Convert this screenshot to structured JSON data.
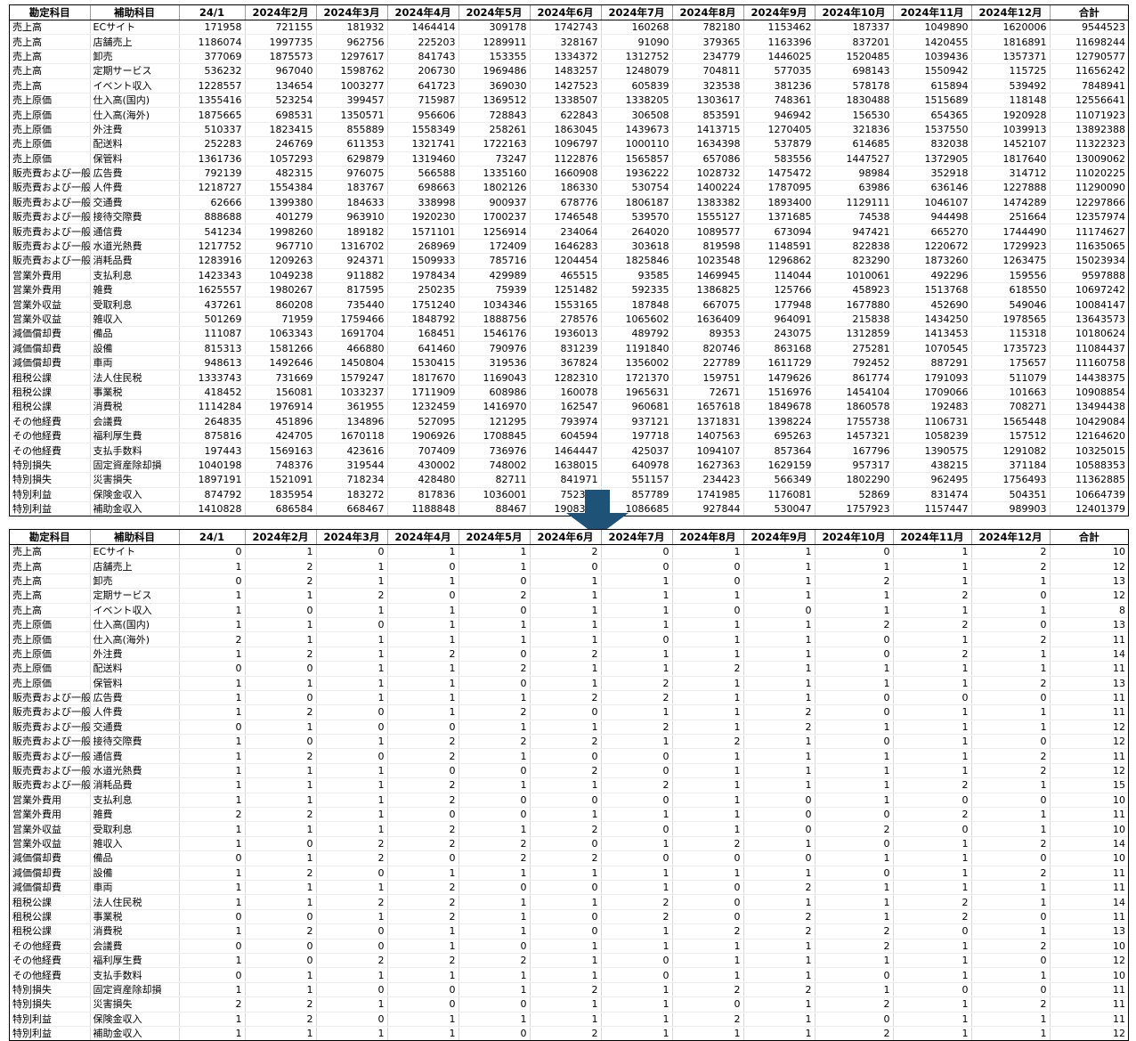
{
  "headers": [
    "勘定科目",
    "補助科目",
    "24/1",
    "2024年2月",
    "2024年3月",
    "2024年4月",
    "2024年5月",
    "2024年6月",
    "2024年7月",
    "2024年8月",
    "2024年9月",
    "2024年10月",
    "2024年11月",
    "2024年12月",
    "合計"
  ],
  "accent_colors": {
    "arrow": "#1f5277",
    "grid_line": "#d9d9d9",
    "border": "#000000"
  },
  "icons": {
    "arrow": "down-arrow-icon"
  },
  "top_rows": [
    [
      "売上高",
      "ECサイト",
      "171958",
      "721155",
      "181932",
      "1464414",
      "309178",
      "1742743",
      "160268",
      "782180",
      "1153462",
      "187337",
      "1049890",
      "1620006",
      "9544523"
    ],
    [
      "売上高",
      "店舗売上",
      "1186074",
      "1997735",
      "962756",
      "225203",
      "1289911",
      "328167",
      "91090",
      "379365",
      "1163396",
      "837201",
      "1420455",
      "1816891",
      "11698244"
    ],
    [
      "売上高",
      "卸売",
      "377069",
      "1875573",
      "1297617",
      "841743",
      "153355",
      "1334372",
      "1312752",
      "234779",
      "1446025",
      "1520485",
      "1039436",
      "1357371",
      "12790577"
    ],
    [
      "売上高",
      "定期サービス",
      "536232",
      "967040",
      "1598762",
      "206730",
      "1969486",
      "1483257",
      "1248079",
      "704811",
      "577035",
      "698143",
      "1550942",
      "115725",
      "11656242"
    ],
    [
      "売上高",
      "イベント収入",
      "1228557",
      "134654",
      "1003277",
      "641723",
      "369030",
      "1427523",
      "605839",
      "323538",
      "381236",
      "578178",
      "615894",
      "539492",
      "7848941"
    ],
    [
      "売上原価",
      "仕入高(国内)",
      "1355416",
      "523254",
      "399457",
      "715987",
      "1369512",
      "1338507",
      "1338205",
      "1303617",
      "748361",
      "1830488",
      "1515689",
      "118148",
      "12556641"
    ],
    [
      "売上原価",
      "仕入高(海外)",
      "1875665",
      "698531",
      "1350571",
      "956606",
      "728843",
      "622843",
      "306508",
      "853591",
      "946942",
      "156530",
      "654365",
      "1920928",
      "11071923"
    ],
    [
      "売上原価",
      "外注費",
      "510337",
      "1823415",
      "855889",
      "1558349",
      "258261",
      "1863045",
      "1439673",
      "1413715",
      "1270405",
      "321836",
      "1537550",
      "1039913",
      "13892388"
    ],
    [
      "売上原価",
      "配送料",
      "252283",
      "246769",
      "611353",
      "1321741",
      "1722163",
      "1096797",
      "1000110",
      "1634398",
      "537879",
      "614685",
      "832038",
      "1452107",
      "11322323"
    ],
    [
      "売上原価",
      "保管料",
      "1361736",
      "1057293",
      "629879",
      "1319460",
      "73247",
      "1122876",
      "1565857",
      "657086",
      "583556",
      "1447527",
      "1372905",
      "1817640",
      "13009062"
    ],
    [
      "販売費および一般管理費",
      "広告費",
      "792139",
      "482315",
      "976075",
      "566588",
      "1335160",
      "1660908",
      "1936222",
      "1028732",
      "1475472",
      "98984",
      "352918",
      "314712",
      "11020225"
    ],
    [
      "販売費および一般管理費",
      "人件費",
      "1218727",
      "1554384",
      "183767",
      "698663",
      "1802126",
      "186330",
      "530754",
      "1400224",
      "1787095",
      "63986",
      "636146",
      "1227888",
      "11290090"
    ],
    [
      "販売費および一般管理費",
      "交通費",
      "62666",
      "1399380",
      "184633",
      "338998",
      "900937",
      "678776",
      "1806187",
      "1383382",
      "1893400",
      "1129111",
      "1046107",
      "1474289",
      "12297866"
    ],
    [
      "販売費および一般管理費",
      "接待交際費",
      "888688",
      "401279",
      "963910",
      "1920230",
      "1700237",
      "1746548",
      "539570",
      "1555127",
      "1371685",
      "74538",
      "944498",
      "251664",
      "12357974"
    ],
    [
      "販売費および一般管理費",
      "通信費",
      "541234",
      "1998260",
      "189182",
      "1571101",
      "1256914",
      "234064",
      "264020",
      "1089577",
      "673094",
      "947421",
      "665270",
      "1744490",
      "11174627"
    ],
    [
      "販売費および一般管理費",
      "水道光熱費",
      "1217752",
      "967710",
      "1316702",
      "268969",
      "172409",
      "1646283",
      "303618",
      "819598",
      "1148591",
      "822838",
      "1220672",
      "1729923",
      "11635065"
    ],
    [
      "販売費および一般管理費",
      "消耗品費",
      "1283916",
      "1209263",
      "924371",
      "1509933",
      "785716",
      "1204454",
      "1825846",
      "1023548",
      "1296862",
      "823290",
      "1873260",
      "1263475",
      "15023934"
    ],
    [
      "営業外費用",
      "支払利息",
      "1423343",
      "1049238",
      "911882",
      "1978434",
      "429989",
      "465515",
      "93585",
      "1469945",
      "114044",
      "1010061",
      "492296",
      "159556",
      "9597888"
    ],
    [
      "営業外費用",
      "雑費",
      "1625557",
      "1980267",
      "817595",
      "250235",
      "75939",
      "1251482",
      "592335",
      "1386825",
      "125766",
      "458923",
      "1513768",
      "618550",
      "10697242"
    ],
    [
      "営業外収益",
      "受取利息",
      "437261",
      "860208",
      "735440",
      "1751240",
      "1034346",
      "1553165",
      "187848",
      "667075",
      "177948",
      "1677880",
      "452690",
      "549046",
      "10084147"
    ],
    [
      "営業外収益",
      "雑収入",
      "501269",
      "71959",
      "1759466",
      "1848792",
      "1888756",
      "278576",
      "1065602",
      "1636409",
      "964091",
      "215838",
      "1434250",
      "1978565",
      "13643573"
    ],
    [
      "減価償却費",
      "備品",
      "111087",
      "1063343",
      "1691704",
      "168451",
      "1546176",
      "1936013",
      "489792",
      "89353",
      "243075",
      "1312859",
      "1413453",
      "115318",
      "10180624"
    ],
    [
      "減価償却費",
      "設備",
      "815313",
      "1581266",
      "466880",
      "641460",
      "790976",
      "831239",
      "1191840",
      "820746",
      "863168",
      "275281",
      "1070545",
      "1735723",
      "11084437"
    ],
    [
      "減価償却費",
      "車両",
      "948613",
      "1492646",
      "1450804",
      "1530415",
      "319536",
      "367824",
      "1356002",
      "227789",
      "1611729",
      "792452",
      "887291",
      "175657",
      "11160758"
    ],
    [
      "租税公課",
      "法人住民税",
      "1333743",
      "731669",
      "1579247",
      "1817670",
      "1169043",
      "1282310",
      "1721370",
      "159751",
      "1479626",
      "861774",
      "1791093",
      "511079",
      "14438375"
    ],
    [
      "租税公課",
      "事業税",
      "418452",
      "156081",
      "1033237",
      "1711909",
      "608986",
      "160078",
      "1965631",
      "72671",
      "1516976",
      "1454104",
      "1709066",
      "101663",
      "10908854"
    ],
    [
      "租税公課",
      "消費税",
      "1114284",
      "1976914",
      "361955",
      "1232459",
      "1416970",
      "162547",
      "960681",
      "1657618",
      "1849678",
      "1860578",
      "192483",
      "708271",
      "13494438"
    ],
    [
      "その他経費",
      "会議費",
      "264835",
      "451896",
      "134896",
      "527095",
      "121295",
      "793974",
      "937121",
      "1371831",
      "1398224",
      "1755738",
      "1106731",
      "1565448",
      "10429084"
    ],
    [
      "その他経費",
      "福利厚生費",
      "875816",
      "424705",
      "1670118",
      "1906926",
      "1708845",
      "604594",
      "197718",
      "1407563",
      "695263",
      "1457321",
      "1058239",
      "157512",
      "12164620"
    ],
    [
      "その他経費",
      "支払手数料",
      "197443",
      "1569163",
      "423616",
      "707409",
      "736976",
      "1464447",
      "425037",
      "1094107",
      "857364",
      "167796",
      "1390575",
      "1291082",
      "10325015"
    ],
    [
      "特別損失",
      "固定資産除却損",
      "1040198",
      "748376",
      "319544",
      "430002",
      "748002",
      "1638015",
      "640978",
      "1627363",
      "1629159",
      "957317",
      "438215",
      "371184",
      "10588353"
    ],
    [
      "特別損失",
      "災害損失",
      "1897191",
      "1521091",
      "718234",
      "428480",
      "82711",
      "841971",
      "551157",
      "234423",
      "566349",
      "1802290",
      "962495",
      "1756493",
      "11362885"
    ],
    [
      "特別利益",
      "保険金収入",
      "874792",
      "1835954",
      "183272",
      "817836",
      "1036001",
      "752335",
      "857789",
      "1741985",
      "1176081",
      "52869",
      "831474",
      "504351",
      "10664739"
    ],
    [
      "特別利益",
      "補助金収入",
      "1410828",
      "686584",
      "668467",
      "1188848",
      "88467",
      "1908336",
      "1086685",
      "927844",
      "530047",
      "1757923",
      "1157447",
      "989903",
      "12401379"
    ]
  ],
  "bottom_rows": [
    [
      "売上高",
      "ECサイト",
      "0",
      "1",
      "0",
      "1",
      "1",
      "2",
      "0",
      "1",
      "1",
      "0",
      "1",
      "2",
      "10"
    ],
    [
      "売上高",
      "店舗売上",
      "1",
      "2",
      "1",
      "0",
      "1",
      "0",
      "0",
      "0",
      "1",
      "1",
      "1",
      "2",
      "12"
    ],
    [
      "売上高",
      "卸売",
      "0",
      "2",
      "1",
      "1",
      "0",
      "1",
      "1",
      "0",
      "1",
      "2",
      "1",
      "1",
      "13"
    ],
    [
      "売上高",
      "定期サービス",
      "1",
      "1",
      "2",
      "0",
      "2",
      "1",
      "1",
      "1",
      "1",
      "1",
      "2",
      "0",
      "12"
    ],
    [
      "売上高",
      "イベント収入",
      "1",
      "0",
      "1",
      "1",
      "0",
      "1",
      "1",
      "0",
      "0",
      "1",
      "1",
      "1",
      "8"
    ],
    [
      "売上原価",
      "仕入高(国内)",
      "1",
      "1",
      "0",
      "1",
      "1",
      "1",
      "1",
      "1",
      "1",
      "2",
      "2",
      "0",
      "13"
    ],
    [
      "売上原価",
      "仕入高(海外)",
      "2",
      "1",
      "1",
      "1",
      "1",
      "1",
      "0",
      "1",
      "1",
      "0",
      "1",
      "2",
      "11"
    ],
    [
      "売上原価",
      "外注費",
      "1",
      "2",
      "1",
      "2",
      "0",
      "2",
      "1",
      "1",
      "1",
      "0",
      "2",
      "1",
      "14"
    ],
    [
      "売上原価",
      "配送料",
      "0",
      "0",
      "1",
      "1",
      "2",
      "1",
      "1",
      "2",
      "1",
      "1",
      "1",
      "1",
      "11"
    ],
    [
      "売上原価",
      "保管料",
      "1",
      "1",
      "1",
      "1",
      "0",
      "1",
      "2",
      "1",
      "1",
      "1",
      "1",
      "2",
      "13"
    ],
    [
      "販売費および一般管理費",
      "広告費",
      "1",
      "0",
      "1",
      "1",
      "1",
      "2",
      "2",
      "1",
      "1",
      "0",
      "0",
      "0",
      "11"
    ],
    [
      "販売費および一般管理費",
      "人件費",
      "1",
      "2",
      "0",
      "1",
      "2",
      "0",
      "1",
      "1",
      "2",
      "0",
      "1",
      "1",
      "11"
    ],
    [
      "販売費および一般管理費",
      "交通費",
      "0",
      "1",
      "0",
      "0",
      "1",
      "1",
      "2",
      "1",
      "2",
      "1",
      "1",
      "1",
      "12"
    ],
    [
      "販売費および一般管理費",
      "接待交際費",
      "1",
      "0",
      "1",
      "2",
      "2",
      "2",
      "1",
      "2",
      "1",
      "0",
      "1",
      "0",
      "12"
    ],
    [
      "販売費および一般管理費",
      "通信費",
      "1",
      "2",
      "0",
      "2",
      "1",
      "0",
      "0",
      "1",
      "1",
      "1",
      "1",
      "2",
      "11"
    ],
    [
      "販売費および一般管理費",
      "水道光熱費",
      "1",
      "1",
      "1",
      "0",
      "0",
      "2",
      "0",
      "1",
      "1",
      "1",
      "1",
      "2",
      "12"
    ],
    [
      "販売費および一般管理費",
      "消耗品費",
      "1",
      "1",
      "1",
      "2",
      "1",
      "1",
      "2",
      "1",
      "1",
      "1",
      "2",
      "1",
      "15"
    ],
    [
      "営業外費用",
      "支払利息",
      "1",
      "1",
      "1",
      "2",
      "0",
      "0",
      "0",
      "1",
      "0",
      "1",
      "0",
      "0",
      "10"
    ],
    [
      "営業外費用",
      "雑費",
      "2",
      "2",
      "1",
      "0",
      "0",
      "1",
      "1",
      "1",
      "0",
      "0",
      "2",
      "1",
      "11"
    ],
    [
      "営業外収益",
      "受取利息",
      "1",
      "1",
      "1",
      "2",
      "1",
      "2",
      "0",
      "1",
      "0",
      "2",
      "0",
      "1",
      "10"
    ],
    [
      "営業外収益",
      "雑収入",
      "1",
      "0",
      "2",
      "2",
      "2",
      "0",
      "1",
      "2",
      "1",
      "0",
      "1",
      "2",
      "14"
    ],
    [
      "減価償却費",
      "備品",
      "0",
      "1",
      "2",
      "0",
      "2",
      "2",
      "0",
      "0",
      "0",
      "1",
      "1",
      "0",
      "10"
    ],
    [
      "減価償却費",
      "設備",
      "1",
      "2",
      "0",
      "1",
      "1",
      "1",
      "1",
      "1",
      "1",
      "0",
      "1",
      "2",
      "11"
    ],
    [
      "減価償却費",
      "車両",
      "1",
      "1",
      "1",
      "2",
      "0",
      "0",
      "1",
      "0",
      "2",
      "1",
      "1",
      "1",
      "11"
    ],
    [
      "租税公課",
      "法人住民税",
      "1",
      "1",
      "2",
      "2",
      "1",
      "1",
      "2",
      "0",
      "1",
      "1",
      "2",
      "1",
      "14"
    ],
    [
      "租税公課",
      "事業税",
      "0",
      "0",
      "1",
      "2",
      "1",
      "0",
      "2",
      "0",
      "2",
      "1",
      "2",
      "0",
      "11"
    ],
    [
      "租税公課",
      "消費税",
      "1",
      "2",
      "0",
      "1",
      "1",
      "0",
      "1",
      "2",
      "2",
      "2",
      "0",
      "1",
      "13"
    ],
    [
      "その他経費",
      "会議費",
      "0",
      "0",
      "0",
      "1",
      "0",
      "1",
      "1",
      "1",
      "1",
      "2",
      "1",
      "2",
      "10"
    ],
    [
      "その他経費",
      "福利厚生費",
      "1",
      "0",
      "2",
      "2",
      "2",
      "1",
      "0",
      "1",
      "1",
      "1",
      "1",
      "0",
      "12"
    ],
    [
      "その他経費",
      "支払手数料",
      "0",
      "1",
      "1",
      "1",
      "1",
      "1",
      "0",
      "1",
      "1",
      "0",
      "1",
      "1",
      "10"
    ],
    [
      "特別損失",
      "固定資産除却損",
      "1",
      "1",
      "0",
      "0",
      "1",
      "2",
      "1",
      "2",
      "2",
      "1",
      "0",
      "0",
      "11"
    ],
    [
      "特別損失",
      "災害損失",
      "2",
      "2",
      "1",
      "0",
      "0",
      "1",
      "1",
      "0",
      "1",
      "2",
      "1",
      "2",
      "11"
    ],
    [
      "特別利益",
      "保険金収入",
      "1",
      "2",
      "0",
      "1",
      "1",
      "1",
      "1",
      "2",
      "1",
      "0",
      "1",
      "1",
      "11"
    ],
    [
      "特別利益",
      "補助金収入",
      "1",
      "1",
      "1",
      "1",
      "0",
      "2",
      "1",
      "1",
      "1",
      "2",
      "1",
      "1",
      "12"
    ]
  ]
}
